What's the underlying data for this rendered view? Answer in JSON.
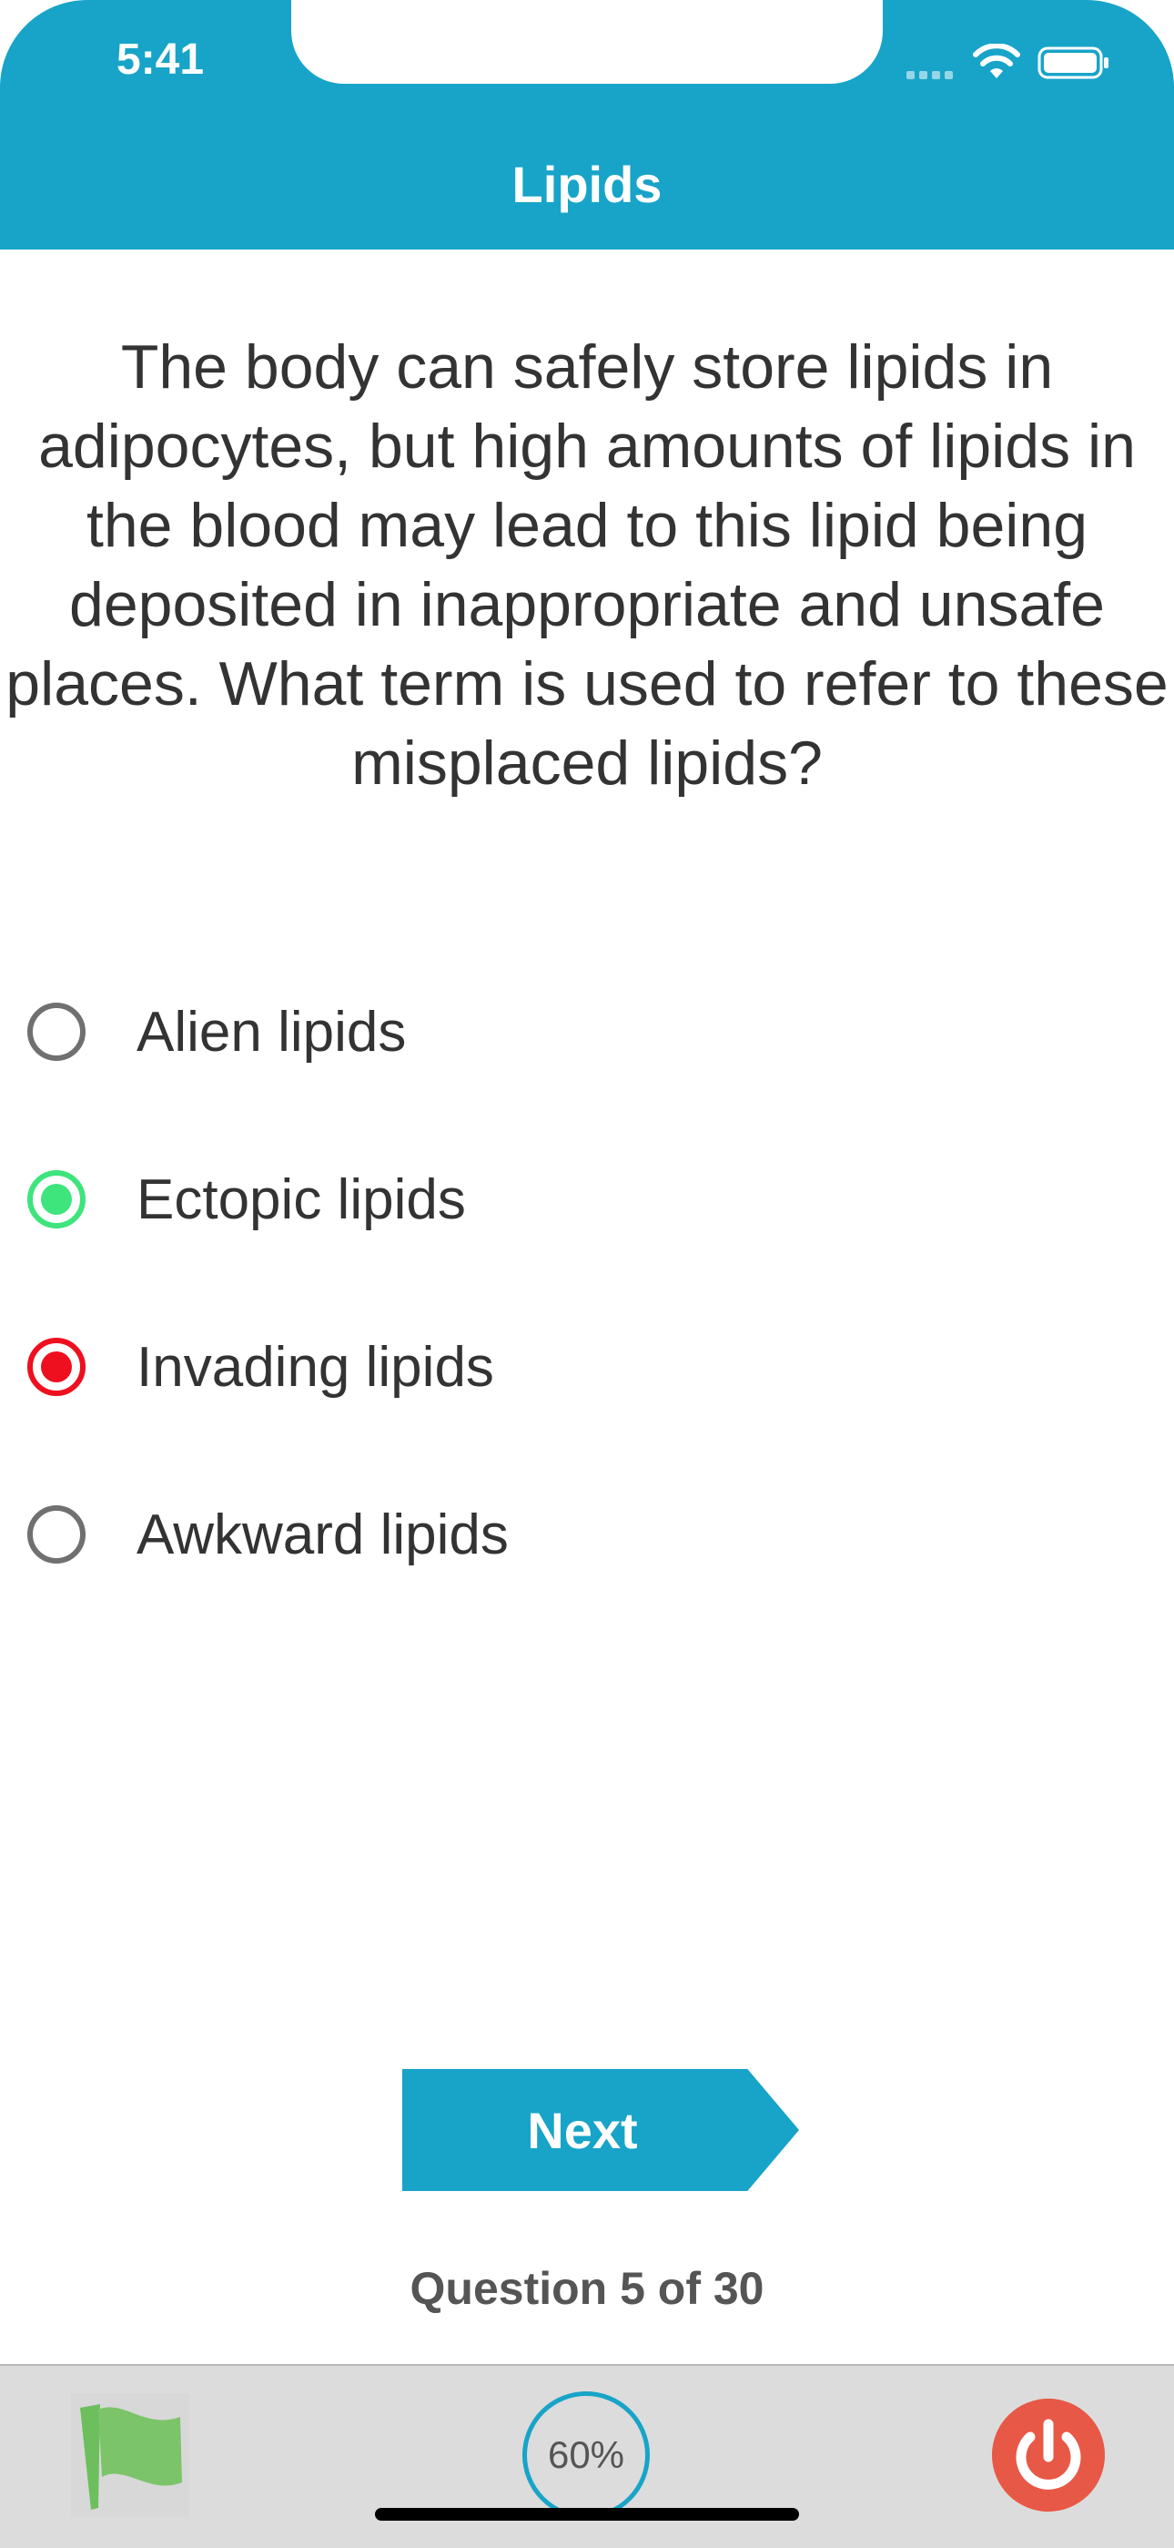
{
  "status_bar": {
    "time": "5:41"
  },
  "header": {
    "title": "Lipids"
  },
  "question": {
    "text": "The body can safely store lipids in adipocytes, but high amounts of lipids in the blood may lead to this lipid being deposited in inappropriate and unsafe places. What term is used to refer to these misplaced lipids?"
  },
  "options": [
    {
      "label": "Alien lipids",
      "state": "unselected"
    },
    {
      "label": "Ectopic lipids",
      "state": "correct"
    },
    {
      "label": "Invading lipids",
      "state": "incorrect"
    },
    {
      "label": "Awkward lipids",
      "state": "unselected"
    }
  ],
  "next_button": {
    "label": "Next"
  },
  "progress_text": "Question 5 of 30",
  "tab_bar": {
    "flag_icon": "flag-icon",
    "score": "60%",
    "power_icon": "power-icon"
  },
  "colors": {
    "accent": "#17a4c8",
    "correct": "#3ee47c",
    "incorrect": "#ee0f1f",
    "power": "#e85846",
    "flag": "#7cc46a"
  }
}
